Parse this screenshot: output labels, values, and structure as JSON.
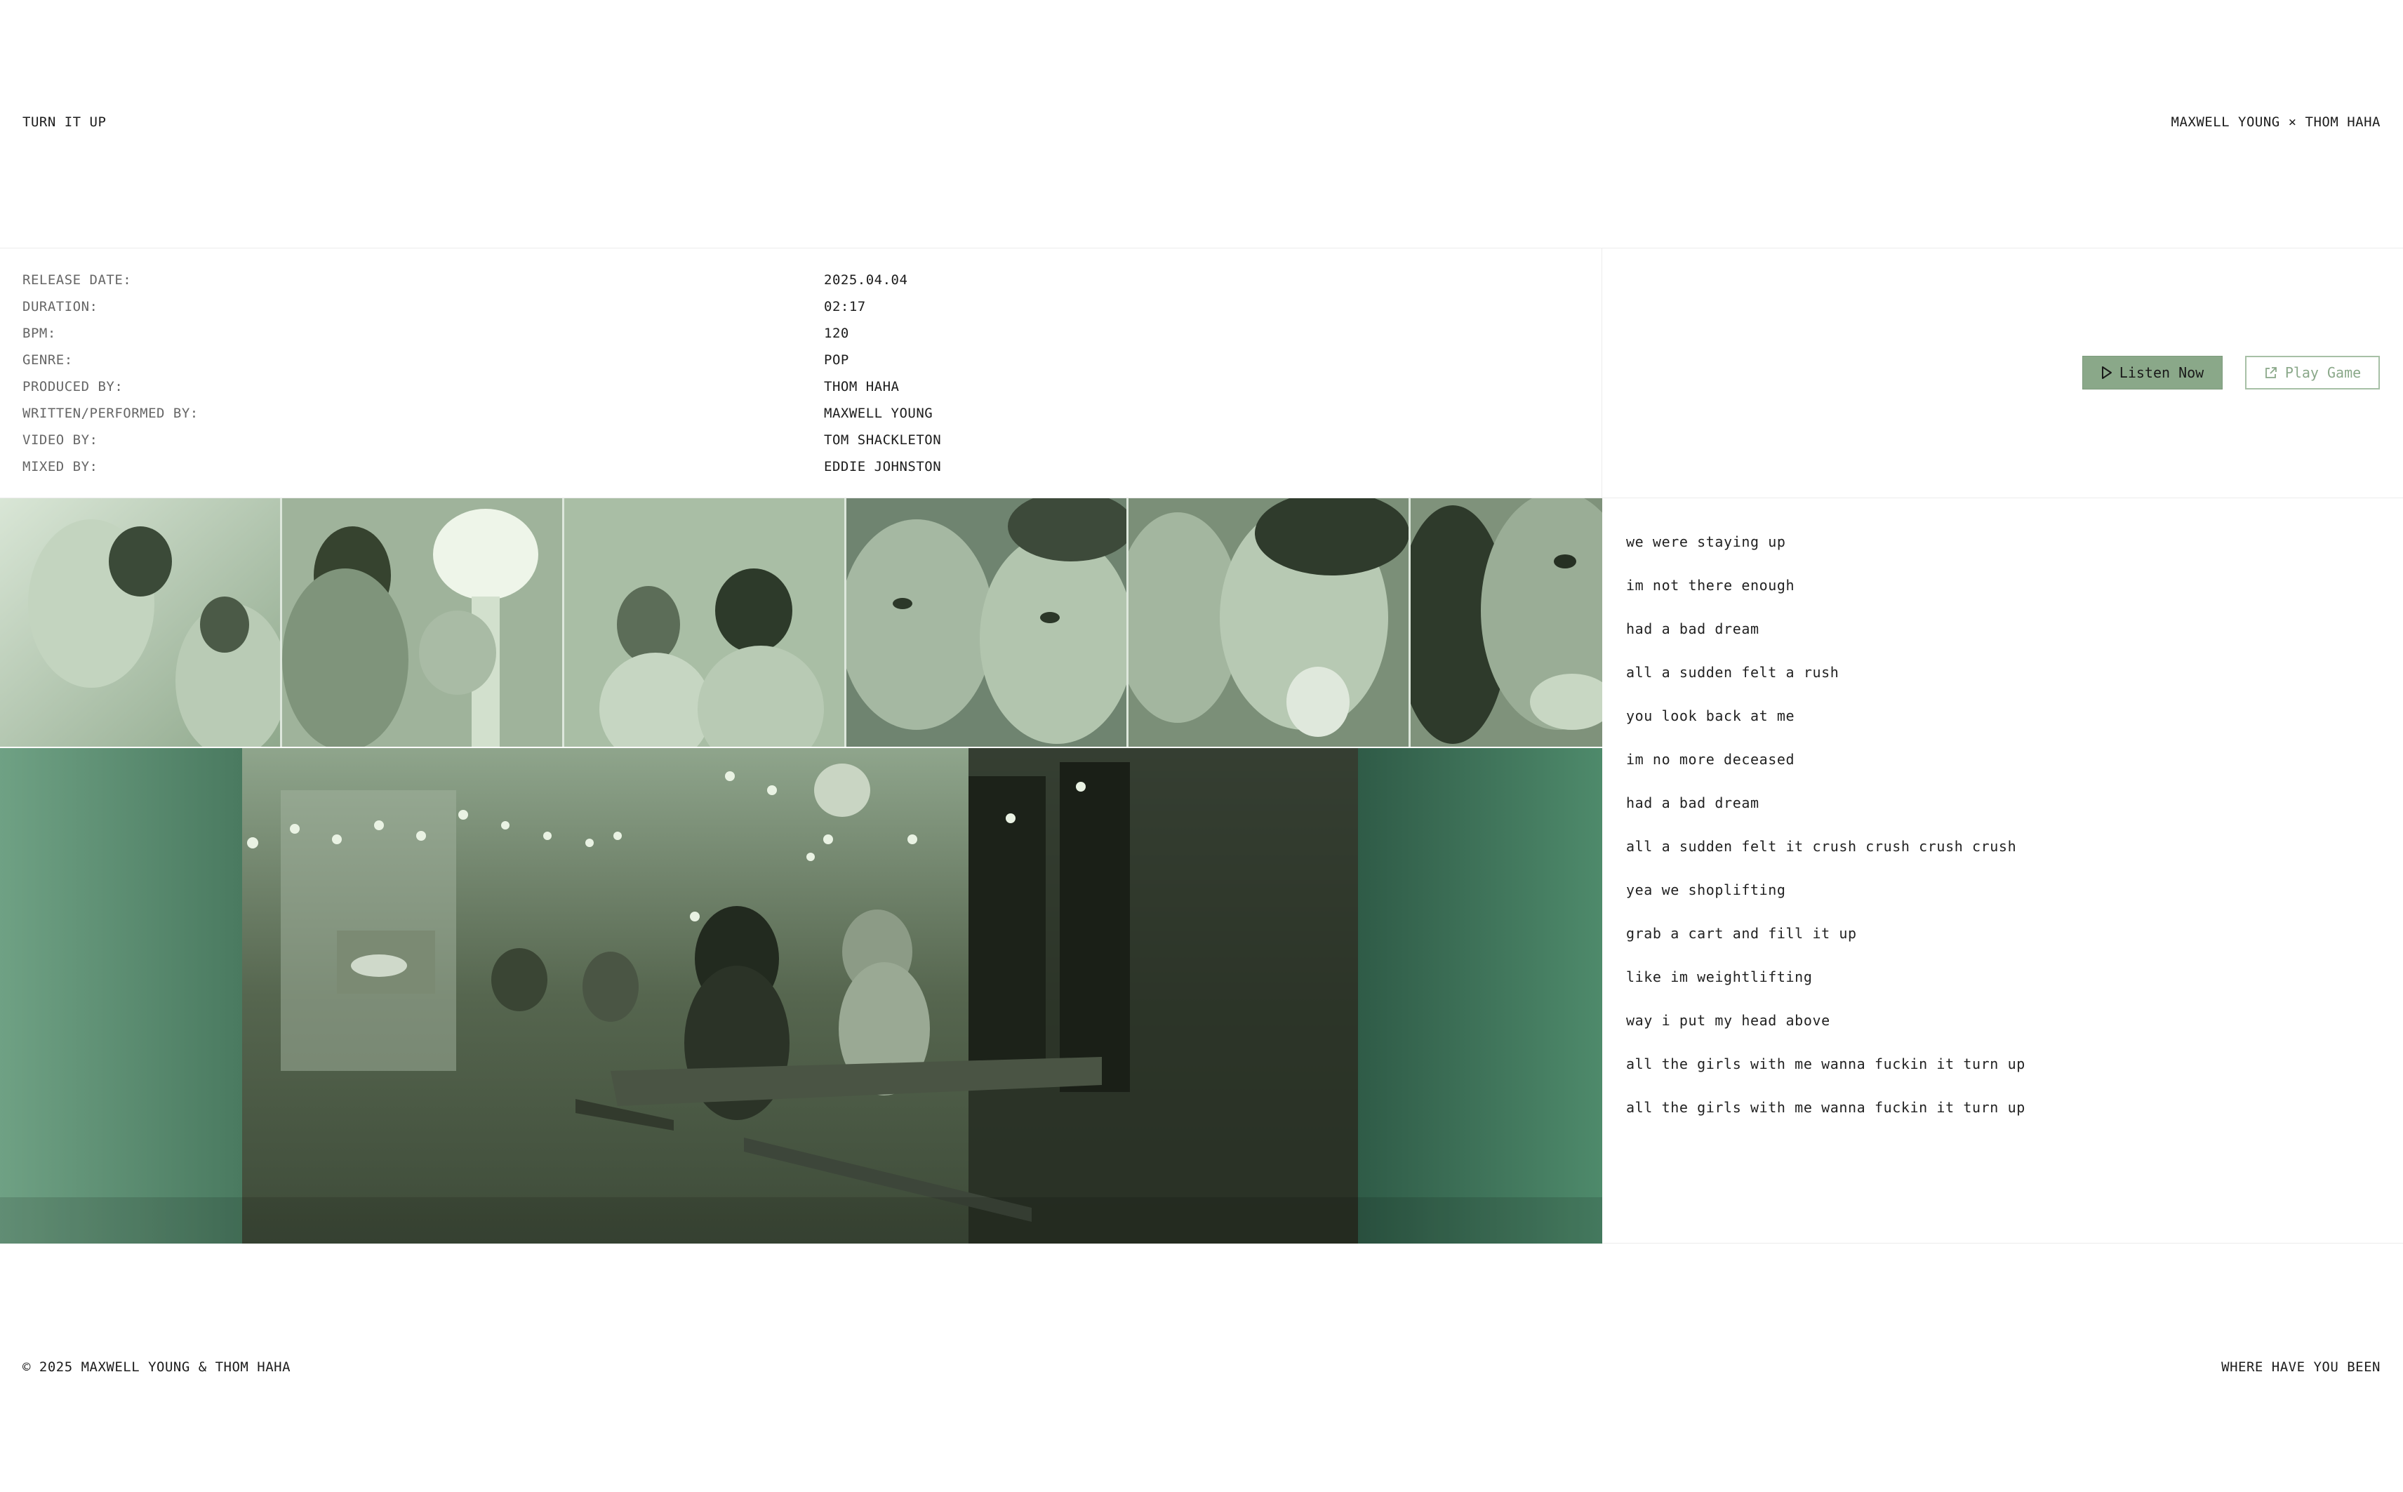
{
  "header": {
    "title": "TURN IT UP",
    "artists": "MAXWELL YOUNG × THOM HAHA"
  },
  "meta": [
    {
      "label": "RELEASE DATE:",
      "value": "2025.04.04"
    },
    {
      "label": "DURATION:",
      "value": "02:17"
    },
    {
      "label": "BPM:",
      "value": "120"
    },
    {
      "label": "GENRE:",
      "value": "POP"
    },
    {
      "label": "PRODUCED BY:",
      "value": "THOM HAHA"
    },
    {
      "label": "WRITTEN/PERFORMED BY:",
      "value": "MAXWELL YOUNG"
    },
    {
      "label": "VIDEO BY:",
      "value": "TOM SHACKLETON"
    },
    {
      "label": "MIXED BY:",
      "value": "EDDIE JOHNSTON"
    }
  ],
  "actions": {
    "listen_label": "Listen Now",
    "listen_icon": "play-icon",
    "game_label": "Play Game",
    "game_icon": "external-link-icon",
    "accent": "#8aa889"
  },
  "lyrics": [
    "we were staying up",
    "im not there enough",
    "had a bad dream",
    "all a sudden felt a rush",
    "you look back at me",
    "im no more deceased",
    "had a bad dream",
    "all a sudden felt it crush crush crush crush",
    "yea we shoplifting",
    "grab a cart and fill it up",
    "like im weightlifting",
    "way i put my head above",
    "all the girls with me wanna fuckin it turn up",
    "all the girls with me wanna fuckin it turn up"
  ],
  "footer": {
    "copyright": "© 2025 MAXWELL YOUNG & THOM HAHA",
    "link": "WHERE HAVE YOU BEEN"
  }
}
